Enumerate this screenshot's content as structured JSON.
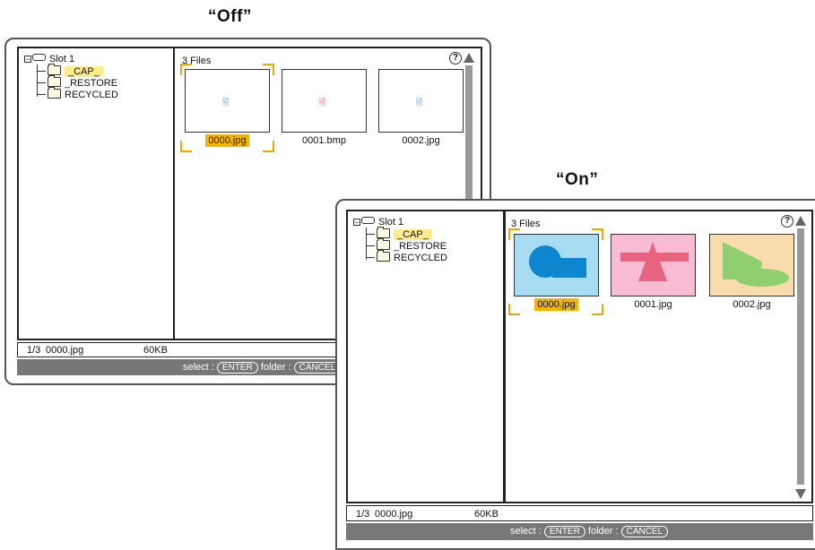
{
  "captions": {
    "off": "“Off”",
    "on": "“On”"
  },
  "off": {
    "tree": {
      "root": "Slot 1",
      "folders": [
        "_CAP_",
        "_RESTORE",
        "RECYCLED"
      ]
    },
    "file_count": "3 Files",
    "help": "?",
    "files": [
      "0000.jpg",
      "0001.bmp",
      "0002.jpg"
    ],
    "status": {
      "position": "1/3",
      "file": "0000.jpg",
      "size": "60KB"
    },
    "hint": {
      "select": "select :",
      "enter": "ENTER",
      "folder": "folder :",
      "cancel": "CANCEL"
    }
  },
  "on": {
    "tree": {
      "root": "Slot 1",
      "folders": [
        "_CAP_",
        "_RESTORE",
        "RECYCLED"
      ]
    },
    "file_count": "3 Files",
    "help": "?",
    "files": [
      "0000.jpg",
      "0001.jpg",
      "0002.jpg"
    ],
    "status": {
      "position": "1/3",
      "file": "0000.jpg",
      "size": "60KB"
    },
    "hint": {
      "select": "select :",
      "enter": "ENTER",
      "folder": "folder :",
      "cancel": "CANCEL"
    }
  },
  "colors": {
    "selection": "#f5b400",
    "highlight": "#ffec8a",
    "thumb0_bg": "#a8dcf3",
    "thumb0_shape": "#0b86cf",
    "thumb1_bg": "#f7bcd3",
    "thumb1_shape": "#e8637f",
    "thumb2_bg": "#f9dcae",
    "thumb2_shape": "#8fcf6e"
  }
}
